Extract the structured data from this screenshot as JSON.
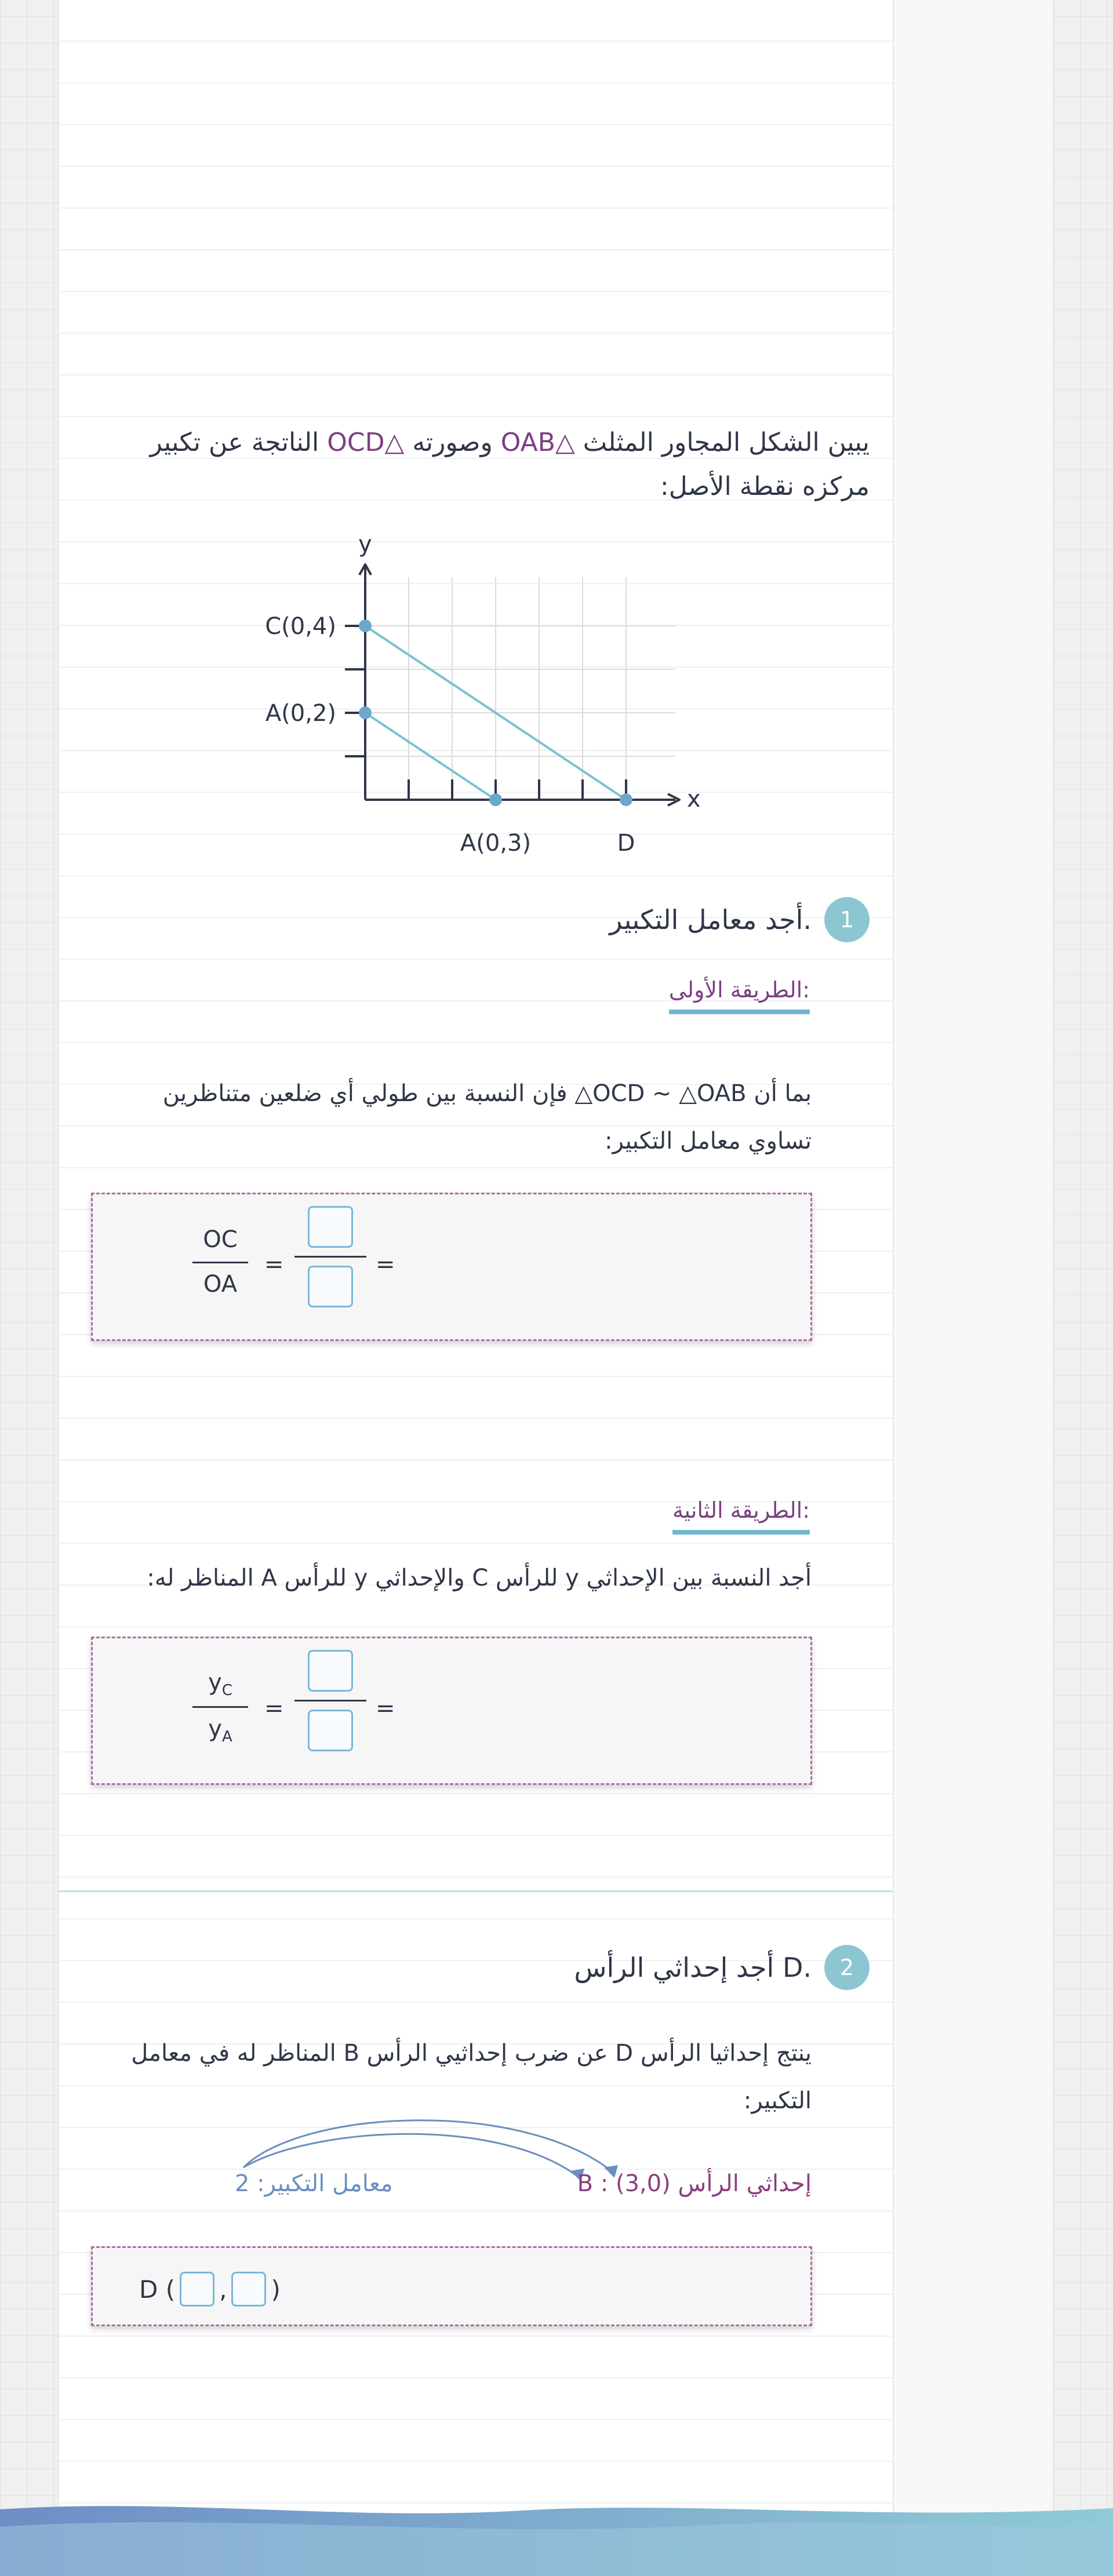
{
  "intro": {
    "part1": "يبين الشكل المجاور المثلث ",
    "tri_oab": "△OAB",
    "part2": " وصورته ",
    "tri_ocd": "△OCD",
    "part3": " الناتجة عن تكبير مركزه نقطة الأصل:"
  },
  "graph": {
    "y_label": "y",
    "x_label": "x",
    "point_c_label": "C(0,4)",
    "point_a_label": "A(0,2)",
    "point_b_label": "A(0,3)",
    "point_d_label": "D",
    "line_color": "#79c3cf",
    "point_color": "#6fa6c9"
  },
  "step1": {
    "badge": "1",
    "title": "أجد معامل التكبير.",
    "method1": {
      "label": "الطريقة الأولى:",
      "text_prefix": "بما أن ",
      "similarity": "△OCD ~ △OAB",
      "text_suffix": "  فإن النسبة بين طولي أي ضلعين متناظرين تساوي معامل التكبير:",
      "numerator": "OC",
      "denominator": "OA",
      "eq1": "=",
      "eq2": "="
    },
    "method2": {
      "label": "الطريقة الثانية:",
      "text": "أجد النسبة بين الإحداثي y للرأس C والإحداثي y للرأس A المناظر له:",
      "numerator_base": "y",
      "numerator_sub": "C",
      "denominator_base": "y",
      "denominator_sub": "A",
      "eq1": "=",
      "eq2": "="
    }
  },
  "step2": {
    "badge": "2",
    "title": "أجد إحداثي الرأس D.",
    "text": "ينتج إحداثيا الرأس D عن ضرب إحداثيي الرأس B المناظر له في معامل التكبير:",
    "vertex_b_note": "إحداثي الرأس B : (3,0)",
    "scale_note": "معامل التكبير: 2",
    "point_prefix": "D (",
    "point_comma": ",",
    "point_suffix": ")"
  },
  "colors": {
    "accent_purple": "#7b3f80",
    "accent_teal": "#8cc7d1",
    "box_border": "#b16aa8"
  }
}
